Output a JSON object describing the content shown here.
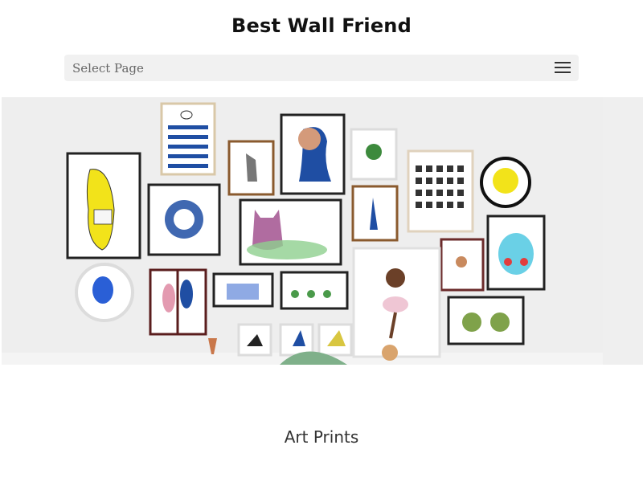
{
  "header": {
    "site_title": "Best Wall Friend"
  },
  "nav": {
    "select_label": "Select Page",
    "menu_icon": "hamburger-menu-icon"
  },
  "hero": {
    "description_hidden": ""
  },
  "sections": {
    "art_prints_title": "Art Prints"
  },
  "colors": {
    "background": "#ffffff",
    "nav_bg": "#f1f1f1",
    "hero_bg": "#eeeeee",
    "accent_blue": "#1f4ea3",
    "accent_yellow": "#f2e31a"
  }
}
